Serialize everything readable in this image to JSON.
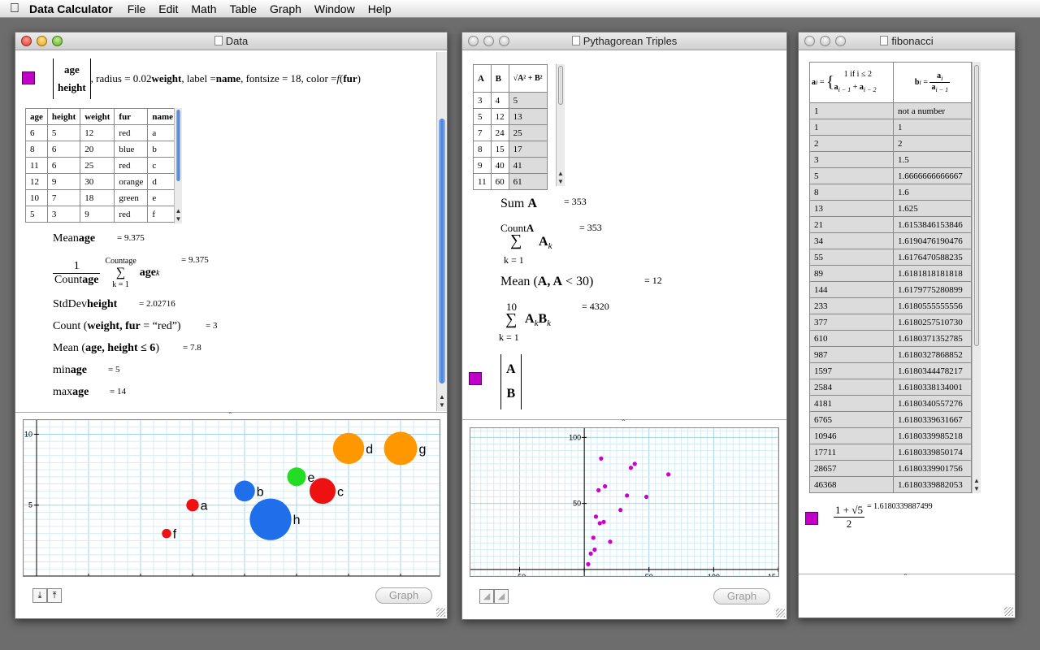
{
  "menubar": {
    "app_name": "Data Calculator",
    "menus": [
      "File",
      "Edit",
      "Math",
      "Table",
      "Graph",
      "Window",
      "Help"
    ]
  },
  "data_window": {
    "title": "Data",
    "graph_cmd": {
      "matrix": [
        "age",
        "height"
      ],
      "p1": ", radius = 0.02",
      "weight": "weight",
      "p2": ", label = ",
      "name": "name",
      "p3": ", fontsize = 18, color = ",
      "f": "f",
      "fur": "fur"
    },
    "table": {
      "headers": [
        "age",
        "height",
        "weight",
        "fur",
        "name"
      ],
      "rows": [
        [
          "6",
          "5",
          "12",
          "red",
          "a"
        ],
        [
          "8",
          "6",
          "20",
          "blue",
          "b"
        ],
        [
          "11",
          "6",
          "25",
          "red",
          "c"
        ],
        [
          "12",
          "9",
          "30",
          "orange",
          "d"
        ],
        [
          "10",
          "7",
          "18",
          "green",
          "e"
        ],
        [
          "5",
          "3",
          "9",
          "red",
          "f"
        ]
      ]
    },
    "calcs": {
      "mean_label": "Mean",
      "mean_arg": "age",
      "mean_result": "= 9.375",
      "frac_num": "1",
      "count_label": "Count",
      "count_arg": "age",
      "sum_top": "Countage",
      "sum_sym": "∑",
      "sum_bottom": "k = 1",
      "sum_term": "age",
      "sum_sub": "k",
      "sum_result": "= 9.375",
      "stddev_label": "StdDev",
      "stddev_arg": "height",
      "stddev_result": "= 2.02716",
      "countw_label": "Count",
      "countw_args": "weight, fur",
      "countw_eq": " = “red”)",
      "countw_result": "= 3",
      "meanh_label": "Mean",
      "meanh_args": "age, height ≤ 6",
      "meanh_result": "= 7.8",
      "min_label": "min",
      "min_arg": "age",
      "min_result": "= 5",
      "max_label": "max",
      "max_arg": "age",
      "max_result": "= 14"
    },
    "graph_button": "Graph"
  },
  "pyth_window": {
    "title": "Pythagorean Triples",
    "table": {
      "headers": [
        "A",
        "B",
        "√A² + B²"
      ],
      "rows": [
        [
          "3",
          "4",
          "5"
        ],
        [
          "5",
          "12",
          "13"
        ],
        [
          "7",
          "24",
          "25"
        ],
        [
          "8",
          "15",
          "17"
        ],
        [
          "9",
          "40",
          "41"
        ],
        [
          "11",
          "60",
          "61"
        ]
      ]
    },
    "calcs": {
      "sum_label": "Sum",
      "sum_arg": "A",
      "sum_result": "= 353",
      "countA_top": "Count",
      "countA_top_arg": "A",
      "sigma": "∑",
      "k1": "k = 1",
      "A": "A",
      "k": "k",
      "countA_result": "= 353",
      "mean_label": "Mean",
      "mean_args_a": "A, A",
      "mean_args_b": " < 30",
      "mean_result": "= 12",
      "ten": "10",
      "B": "B",
      "sumAB_result": "= 4320",
      "matrix": [
        "A",
        "B"
      ]
    },
    "graph_button": "Graph"
  },
  "fib_window": {
    "title": "fibonacci",
    "header_a": {
      "lhs": "a",
      "lhs_sub": "i",
      "case1": "1 if i ≤ 2",
      "case2a": "a",
      "case2a_sub": "i − 1",
      "plus": " + ",
      "case2b": "a",
      "case2b_sub": "i − 2"
    },
    "header_b": {
      "lhs": "b",
      "lhs_sub": "i",
      "num": "a",
      "num_sub": "i",
      "den": "a",
      "den_sub": "i − 1"
    },
    "rows": [
      [
        "1",
        "not a number"
      ],
      [
        "1",
        "1"
      ],
      [
        "2",
        "2"
      ],
      [
        "3",
        "1.5"
      ],
      [
        "5",
        "1.6666666666667"
      ],
      [
        "8",
        "1.6"
      ],
      [
        "13",
        "1.625"
      ],
      [
        "21",
        "1.6153846153846"
      ],
      [
        "34",
        "1.6190476190476"
      ],
      [
        "55",
        "1.6176470588235"
      ],
      [
        "89",
        "1.6181818181818"
      ],
      [
        "144",
        "1.6179775280899"
      ],
      [
        "233",
        "1.6180555555556"
      ],
      [
        "377",
        "1.6180257510730"
      ],
      [
        "610",
        "1.6180371352785"
      ],
      [
        "987",
        "1.6180327868852"
      ],
      [
        "1597",
        "1.6180344478217"
      ],
      [
        "2584",
        "1.6180338134001"
      ],
      [
        "4181",
        "1.6180340557276"
      ],
      [
        "6765",
        "1.6180339631667"
      ],
      [
        "10946",
        "1.6180339985218"
      ],
      [
        "17711",
        "1.6180339850174"
      ],
      [
        "28657",
        "1.6180339901756"
      ],
      [
        "46368",
        "1.6180339882053"
      ]
    ],
    "golden": {
      "num": "1 + √5",
      "den": "2",
      "result": "= 1.6180339887499"
    }
  },
  "chart_data": [
    {
      "type": "scatter",
      "title": "",
      "xlabel": "",
      "ylabel": "",
      "xlim": [
        -0.5,
        15.5
      ],
      "ylim": [
        0,
        11
      ],
      "xticks": [
        "2",
        "4",
        "6",
        "8",
        "10",
        "12",
        "14"
      ],
      "yticks": [
        "5",
        "10"
      ],
      "grid": true,
      "points": [
        {
          "label": "a",
          "x": 6,
          "y": 5,
          "r": 12,
          "color": "#ee1111"
        },
        {
          "label": "b",
          "x": 8,
          "y": 6,
          "r": 20,
          "color": "#1f6fea"
        },
        {
          "label": "c",
          "x": 11,
          "y": 6,
          "r": 25,
          "color": "#ee1111"
        },
        {
          "label": "d",
          "x": 12,
          "y": 9,
          "r": 30,
          "color": "#ff9800"
        },
        {
          "label": "e",
          "x": 10,
          "y": 7,
          "r": 18,
          "color": "#22dd22"
        },
        {
          "label": "f",
          "x": 5,
          "y": 3,
          "r": 9,
          "color": "#ee1111"
        },
        {
          "label": "g",
          "x": 14,
          "y": 9,
          "r": 32,
          "color": "#ff9800"
        },
        {
          "label": "h",
          "x": 9,
          "y": 4,
          "r": 40,
          "color": "#1f6fea"
        }
      ]
    },
    {
      "type": "scatter",
      "title": "",
      "xlabel": "",
      "ylabel": "",
      "xlim": [
        -88,
        150
      ],
      "ylim": [
        -5,
        107
      ],
      "xticks": [
        "−50",
        "0",
        "50",
        "100",
        "15"
      ],
      "yticks": [
        "50",
        "100"
      ],
      "grid": true,
      "color": "#cc00cc",
      "points": [
        [
          3,
          4
        ],
        [
          5,
          12
        ],
        [
          7,
          24
        ],
        [
          8,
          15
        ],
        [
          9,
          40
        ],
        [
          11,
          60
        ],
        [
          12,
          35
        ],
        [
          13,
          84
        ],
        [
          15,
          36
        ],
        [
          16,
          63
        ],
        [
          20,
          21
        ],
        [
          28,
          45
        ],
        [
          33,
          56
        ],
        [
          36,
          77
        ],
        [
          39,
          80
        ],
        [
          48,
          55
        ],
        [
          65,
          72
        ]
      ]
    }
  ]
}
